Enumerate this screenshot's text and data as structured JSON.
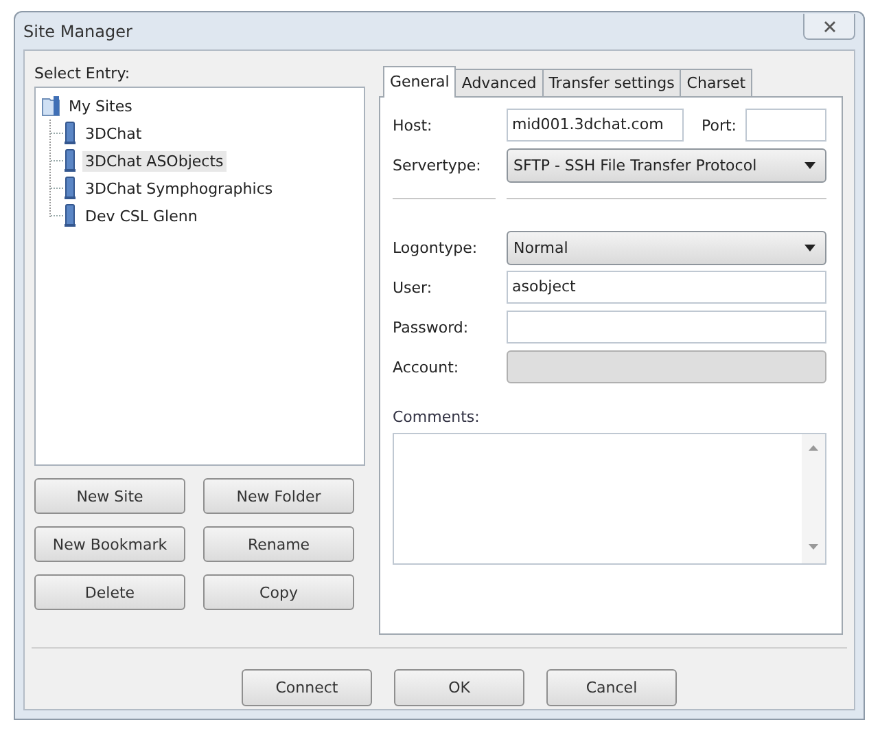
{
  "window": {
    "title": "Site Manager"
  },
  "select_entry": {
    "label": "Select Entry:",
    "tree": {
      "label": "My Sites",
      "children": [
        {
          "label": "3DChat",
          "selected": false
        },
        {
          "label": "3DChat ASObjects",
          "selected": true
        },
        {
          "label": "3DChat Symphographics",
          "selected": false
        },
        {
          "label": "Dev CSL Glenn",
          "selected": false
        }
      ]
    }
  },
  "site_buttons": [
    "New Site",
    "New Folder",
    "New Bookmark",
    "Rename",
    "Delete",
    "Copy"
  ],
  "tabs": [
    {
      "label": "General",
      "selected": true
    },
    {
      "label": "Advanced",
      "selected": false
    },
    {
      "label": "Transfer settings",
      "selected": false
    },
    {
      "label": "Charset",
      "selected": false
    }
  ],
  "form": [
    {
      "kind": "host",
      "label": "Host:",
      "value": "mid001.3dchat.com",
      "port_label": "Port:"
    },
    {
      "kind": "select",
      "label": "Servertype:",
      "value": "SFTP - SSH File Transfer Protocol"
    },
    {
      "kind": "separator"
    },
    {
      "kind": "select",
      "label": "Logontype:",
      "value": "Normal"
    },
    {
      "kind": "text",
      "label": "User:",
      "value": "asobject",
      "disabled": false
    },
    {
      "kind": "text",
      "label": "Password:",
      "disabled": false
    },
    {
      "kind": "text",
      "label": "Account:",
      "disabled": true
    }
  ],
  "comments": {
    "label": "Comments:"
  },
  "dialog_buttons": [
    "Connect",
    "OK",
    "Cancel"
  ]
}
